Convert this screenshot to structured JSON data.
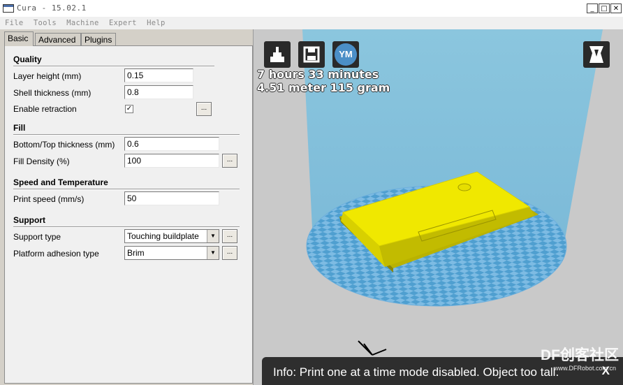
{
  "window": {
    "title": "Cura - 15.02.1",
    "controls": [
      "_",
      "□",
      "✕"
    ]
  },
  "menubar": [
    "File",
    "Tools",
    "Machine",
    "Expert",
    "Help"
  ],
  "tabs": [
    "Basic",
    "Advanced",
    "Plugins"
  ],
  "quality": {
    "header": "Quality",
    "layer_height_label": "Layer height (mm)",
    "layer_height_value": "0.15",
    "shell_thickness_label": "Shell thickness (mm)",
    "shell_thickness_value": "0.8",
    "retraction_label": "Enable retraction",
    "retraction_checked": "✓"
  },
  "fill": {
    "header": "Fill",
    "bottom_top_label": "Bottom/Top thickness (mm)",
    "bottom_top_value": "0.6",
    "density_label": "Fill Density (%)",
    "density_value": "100"
  },
  "speed": {
    "header": "Speed and Temperature",
    "print_speed_label": "Print speed (mm/s)",
    "print_speed_value": "50"
  },
  "support": {
    "header": "Support",
    "support_type_label": "Support type",
    "support_type_value": "Touching buildplate",
    "adhesion_label": "Platform adhesion type",
    "adhesion_value": "Brim"
  },
  "dots_label": "...",
  "viewport": {
    "print_time": "7 hours 33 minutes",
    "material": "4.51 meter 115 gram",
    "ym_label": "YM",
    "info_text": "Info: Print one at a time mode disabled. Object too tall.",
    "info_close": "X",
    "watermark": "DF创客社区",
    "watermark_url": "www.DFRobot.com.cn",
    "colors": {
      "build_volume": "#87c4dc",
      "checker_dark": "#4f9fd0",
      "checker_light": "#7dbbe3",
      "model": "#f0e800"
    }
  }
}
